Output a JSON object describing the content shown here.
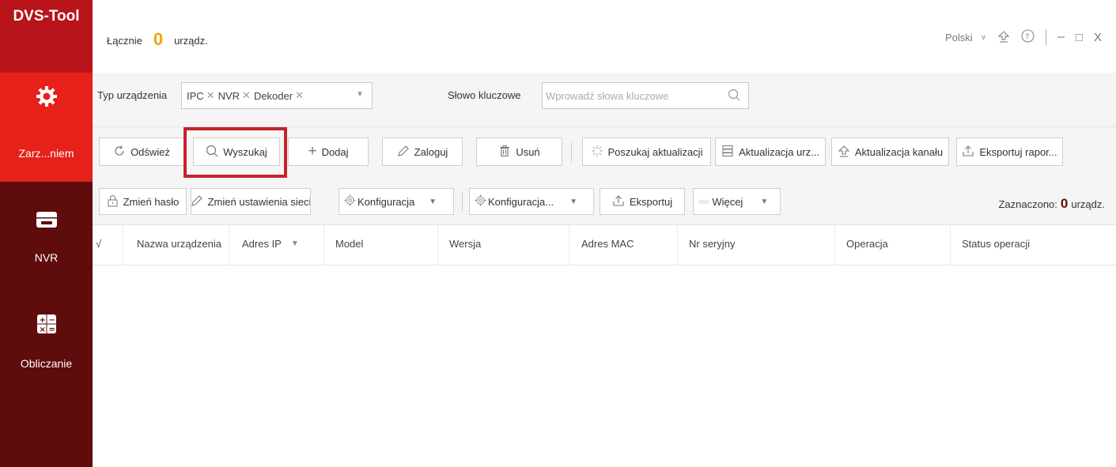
{
  "app": {
    "logo": "DVS-Tool"
  },
  "sidebar": {
    "items": [
      {
        "label": "Zarz...niem",
        "icon": "gear-icon",
        "active": true
      },
      {
        "label": "NVR",
        "icon": "nvr-icon",
        "active": false
      },
      {
        "label": "Obliczanie",
        "icon": "calculator-icon",
        "active": false
      }
    ]
  },
  "header": {
    "total_label": "Łącznie",
    "total_count": "0",
    "total_unit": "urządz.",
    "language": "Polski",
    "window": {
      "minimize": "–",
      "maximize": "□",
      "close": "X"
    }
  },
  "filter": {
    "type_label": "Typ urządzenia",
    "types": [
      "IPC",
      "NVR",
      "Dekoder"
    ],
    "keyword_label": "Słowo kluczowe",
    "keyword_placeholder": "Wprowadź słowa kluczowe"
  },
  "toolbar1": {
    "refresh": "Odśwież",
    "search": "Wyszukaj",
    "add": "Dodaj",
    "login": "Zaloguj",
    "delete": "Usuń",
    "check_updates": "Poszukaj aktualizacji",
    "device_update": "Aktualizacja urz...",
    "channel_update": "Aktualizacja kanału",
    "export_report": "Eksportuj rapor..."
  },
  "toolbar2": {
    "change_password": "Zmień hasło",
    "network_settings": "Zmień ustawienia sieci",
    "config1": "Konfiguracja",
    "config2": "Konfiguracja...",
    "export": "Eksportuj",
    "more": "Więcej",
    "selected_label": "Zaznaczono:",
    "selected_count": "0",
    "selected_unit": "urządz."
  },
  "table": {
    "check": "√",
    "columns": [
      "Nazwa urządzenia",
      "Adres IP",
      "Model",
      "Wersja",
      "Adres MAC",
      "Nr seryjny",
      "Operacja",
      "Status operacji"
    ]
  },
  "colors": {
    "brand": "#b8141b",
    "sidebar": "#5e0c0c",
    "active": "#e5211a",
    "highlight": "#c4232a",
    "count": "#f2a30f"
  }
}
